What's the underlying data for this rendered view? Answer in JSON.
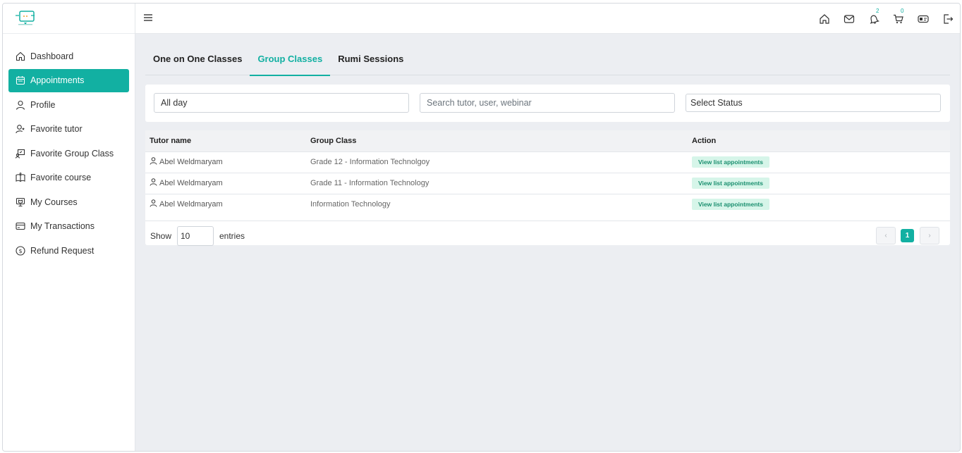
{
  "sidebar": {
    "items": [
      {
        "label": "Dashboard",
        "icon": "home-icon",
        "active": false
      },
      {
        "label": "Appointments",
        "icon": "calendar-icon",
        "active": true
      },
      {
        "label": "Profile",
        "icon": "user-icon",
        "active": false
      },
      {
        "label": "Favorite tutor",
        "icon": "user-star-icon",
        "active": false
      },
      {
        "label": "Favorite Group Class",
        "icon": "presentation-icon",
        "active": false
      },
      {
        "label": "Favorite course",
        "icon": "book-open-icon",
        "active": false
      },
      {
        "label": "My Courses",
        "icon": "monitor-book-icon",
        "active": false
      },
      {
        "label": "My Transactions",
        "icon": "credit-card-icon",
        "active": false
      },
      {
        "label": "Refund Request",
        "icon": "dollar-circle-icon",
        "active": false
      }
    ]
  },
  "header": {
    "notifications_count": "2",
    "cart_count": "0",
    "icons": [
      "home-icon",
      "mail-icon",
      "bell-icon",
      "cart-icon",
      "id-card-icon",
      "logout-icon"
    ]
  },
  "tabs": [
    {
      "label": "One on One Classes",
      "active": false
    },
    {
      "label": "Group Classes",
      "active": true
    },
    {
      "label": "Rumi Sessions",
      "active": false
    }
  ],
  "filters": {
    "date_value": "All day",
    "search_placeholder": "Search tutor, user, webinar",
    "status_value": "Select Status"
  },
  "table": {
    "columns": [
      "Tutor name",
      "Group Class",
      "Action"
    ],
    "rows": [
      {
        "tutor": "Abel Weldmaryam",
        "group_class": "Grade 12 - Information Technolgoy",
        "action": "View list appointments"
      },
      {
        "tutor": "Abel Weldmaryam",
        "group_class": "Grade 11 - Information Technology",
        "action": "View list appointments"
      },
      {
        "tutor": "Abel Weldmaryam",
        "group_class": "Information Technology",
        "action": "View list appointments"
      }
    ],
    "show_label": "Show",
    "entries_value": "10",
    "entries_label": "entries",
    "current_page": "1"
  },
  "colors": {
    "accent": "#12b0a2",
    "action_bg": "#d6f5e9",
    "action_text": "#1a8f6f"
  }
}
